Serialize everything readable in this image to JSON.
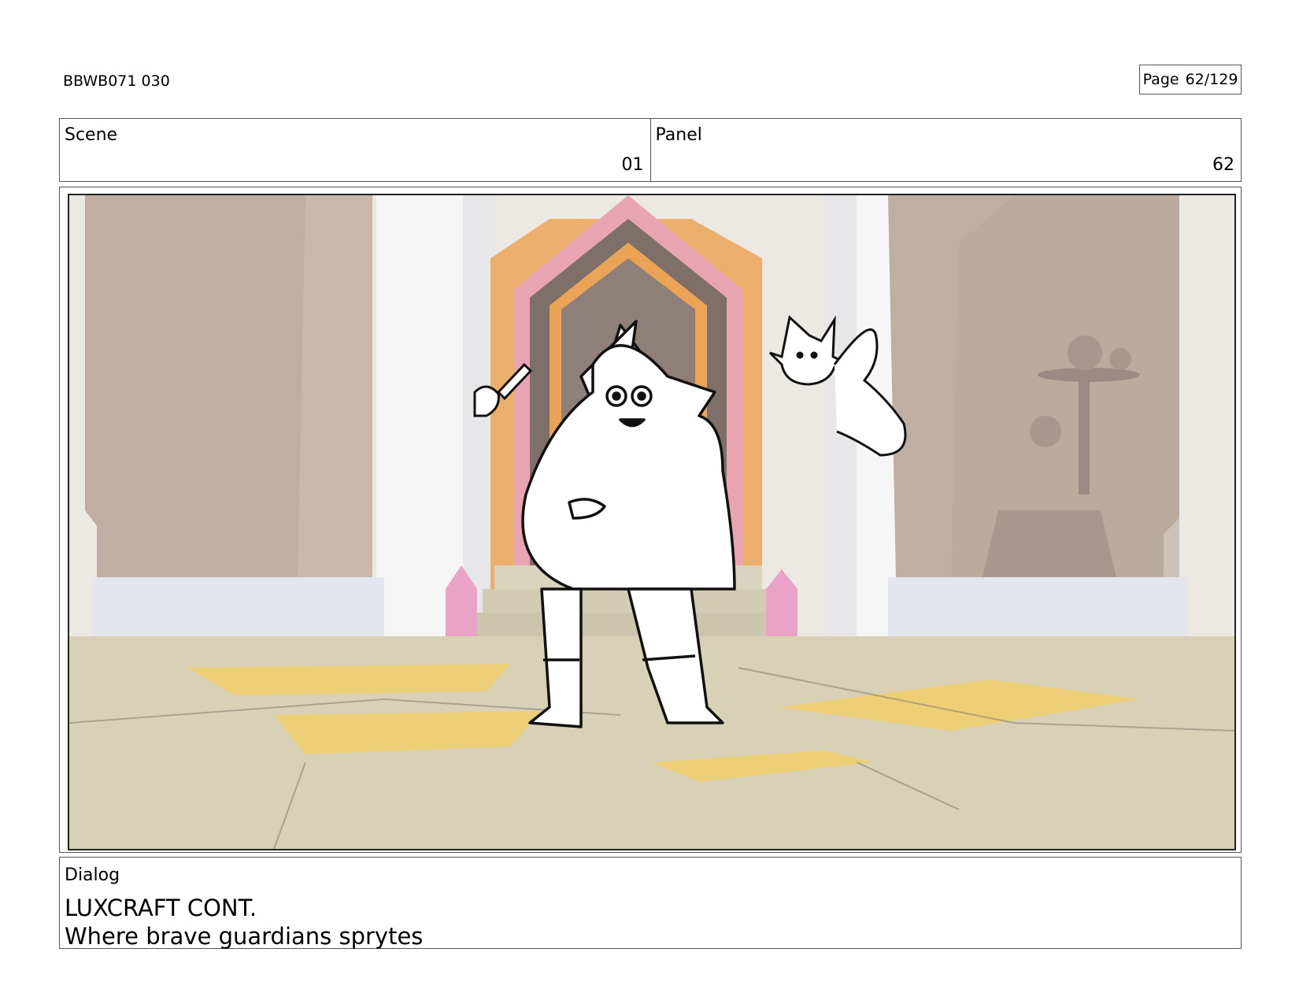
{
  "header": {
    "doc_id": "BBWB071 030",
    "page_label": "Page",
    "page_number": "62/129"
  },
  "scene": {
    "label": "Scene",
    "value": "01"
  },
  "panel": {
    "label": "Panel",
    "value": "62"
  },
  "dialog": {
    "label": "Dialog",
    "lines": [
      "LUXCRAFT CONT.",
      "Where brave guardians sprytes"
    ]
  },
  "colors": {
    "border": "#555555",
    "wall_brown": "#bfaea1",
    "floor": "#d8d1b6",
    "floor_tile_yellow": "#f1cf6c",
    "arch_orange": "#eba456",
    "arch_pink": "#e9a4b4",
    "arch_dark": "#7e6f68",
    "crystal_pink": "#eaa2c6"
  },
  "icons": [
    "wizard-gnome-sketch",
    "paintbrush-sketch",
    "spryte-creature-sketch"
  ]
}
